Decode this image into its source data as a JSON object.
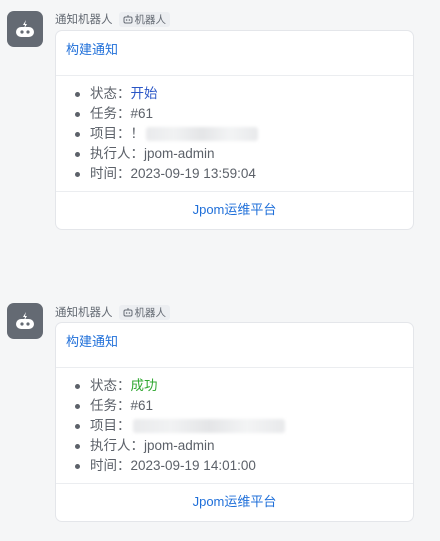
{
  "messages": [
    {
      "sender": "通知机器人",
      "bot_tag": "机器人",
      "card": {
        "title": "构建通知",
        "fields": [
          {
            "label": "状态：",
            "value": "开始",
            "status": "start"
          },
          {
            "label": "任务：",
            "value": "#61"
          },
          {
            "label": "项目：",
            "value": "！"
          },
          {
            "label": "执行人：",
            "value": "jpom-admin"
          },
          {
            "label": "时间：",
            "value": "2023-09-19 13:59:04"
          }
        ],
        "footer": "Jpom运维平台"
      }
    },
    {
      "sender": "通知机器人",
      "bot_tag": "机器人",
      "card": {
        "title": "构建通知",
        "fields": [
          {
            "label": "状态：",
            "value": "成功",
            "status": "success"
          },
          {
            "label": "任务：",
            "value": "#61"
          },
          {
            "label": "项目：",
            "value": ""
          },
          {
            "label": "执行人：",
            "value": "jpom-admin"
          },
          {
            "label": "时间：",
            "value": "2023-09-19 14:01:00"
          }
        ],
        "footer": "Jpom运维平台"
      }
    }
  ],
  "icons": {
    "avatar": "robot-icon",
    "tag": "robot-icon"
  },
  "colors": {
    "link": "#1f6fd9",
    "status_start": "#2a56c6",
    "status_success": "#31a832",
    "avatar_bg": "#646a73"
  }
}
